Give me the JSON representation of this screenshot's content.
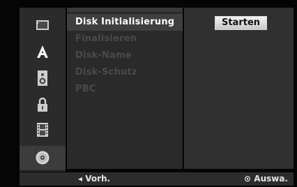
{
  "sidebar": {
    "items": [
      {
        "icon": "film-display-icon"
      },
      {
        "icon": "letter-a-icon"
      },
      {
        "icon": "speaker-icon"
      },
      {
        "icon": "padlock-icon"
      },
      {
        "icon": "filmstrip-icon"
      },
      {
        "icon": "disc-icon"
      }
    ],
    "active_index": 5
  },
  "menu": {
    "items": [
      {
        "label": "Disk Initialisierung",
        "active": true
      },
      {
        "label": "Finalisieren",
        "active": false
      },
      {
        "label": "Disk-Name",
        "active": false
      },
      {
        "label": "Disk-Schutz",
        "active": false
      },
      {
        "label": "PBC",
        "active": false
      }
    ]
  },
  "option": {
    "button_label": "Starten"
  },
  "footer": {
    "left_hint": "◂ Vorh.",
    "right_hint": "⊙ Auswa."
  },
  "colors": {
    "menu_active_text": "#ffffff",
    "menu_inactive_text": "#4a4a4a",
    "button_bg": "#e6e6e6"
  }
}
